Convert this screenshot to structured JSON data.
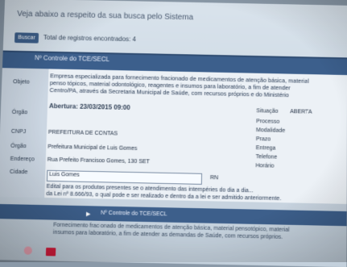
{
  "page": {
    "title": "Veja abaixo a respeito da sua busca pelo Sistema",
    "filter_label": "Total de registros encontrados: 4",
    "search_button": "Buscar"
  },
  "record": {
    "tab_label": "Nº Controle do TCE/SECL",
    "fields": {
      "objeto_label": "Objeto",
      "orgao_label": "Órgão",
      "cnpj_label": "CNPJ",
      "orgao2_label": "Órgão",
      "endereco_label": "Endereço",
      "cidade_label": "Cidade"
    },
    "description_lines": [
      "Empresa especializada para fornecimento fracionado de medicamentos de atenção básica, material",
      "penso tópicos, material odontológico, reagentes e insumos para laboratório, a fim de atender",
      "Centro/PA, através da Secretaria Municipal de Saúde, com recursos próprios e do Ministério"
    ],
    "meta": {
      "date_label": "Abertura: 23/03/2015 09:00",
      "right_label_1": "Situação",
      "right_value_1": "ABERTA",
      "right_label_2": "Processo",
      "right_label_3": "Modalidade",
      "right_label_4": "Prazo",
      "right_label_5": "Entrega",
      "right_label_6": "Telefone",
      "right_label_7": "Horário",
      "cnpj_value": "PREFEITURA DE CONTAS",
      "orgao_value": "Prefeitura Municipal de Luis Gomes",
      "endereco_value": "Rua Prefeito Francisco Gomes, 130 SET",
      "cidade_value": "Luis Gomes",
      "uf_value": "RN"
    },
    "note_lines": [
      "Edital para os produtos presentes se o atendimento das intempéries do dia a dia...",
      "da Lei nº 8.666/93, o qual pode e ser realizado e dentro da a lei e ser admitido anteriormente."
    ]
  },
  "bottom": {
    "tab_label": "Nº Controle do TCE/SECL",
    "text_lines": [
      "Fornecimento fracionado de medicamentos de atenção básica, material pensotópico, material",
      "insumos para laboratório, a fim de atender as demandas de Saúde, com recursos próprios."
    ]
  },
  "colors": {
    "accent": "#3c5f8c",
    "panel_bg": "#ecf1f6",
    "stray_red": "#d21c3c"
  }
}
